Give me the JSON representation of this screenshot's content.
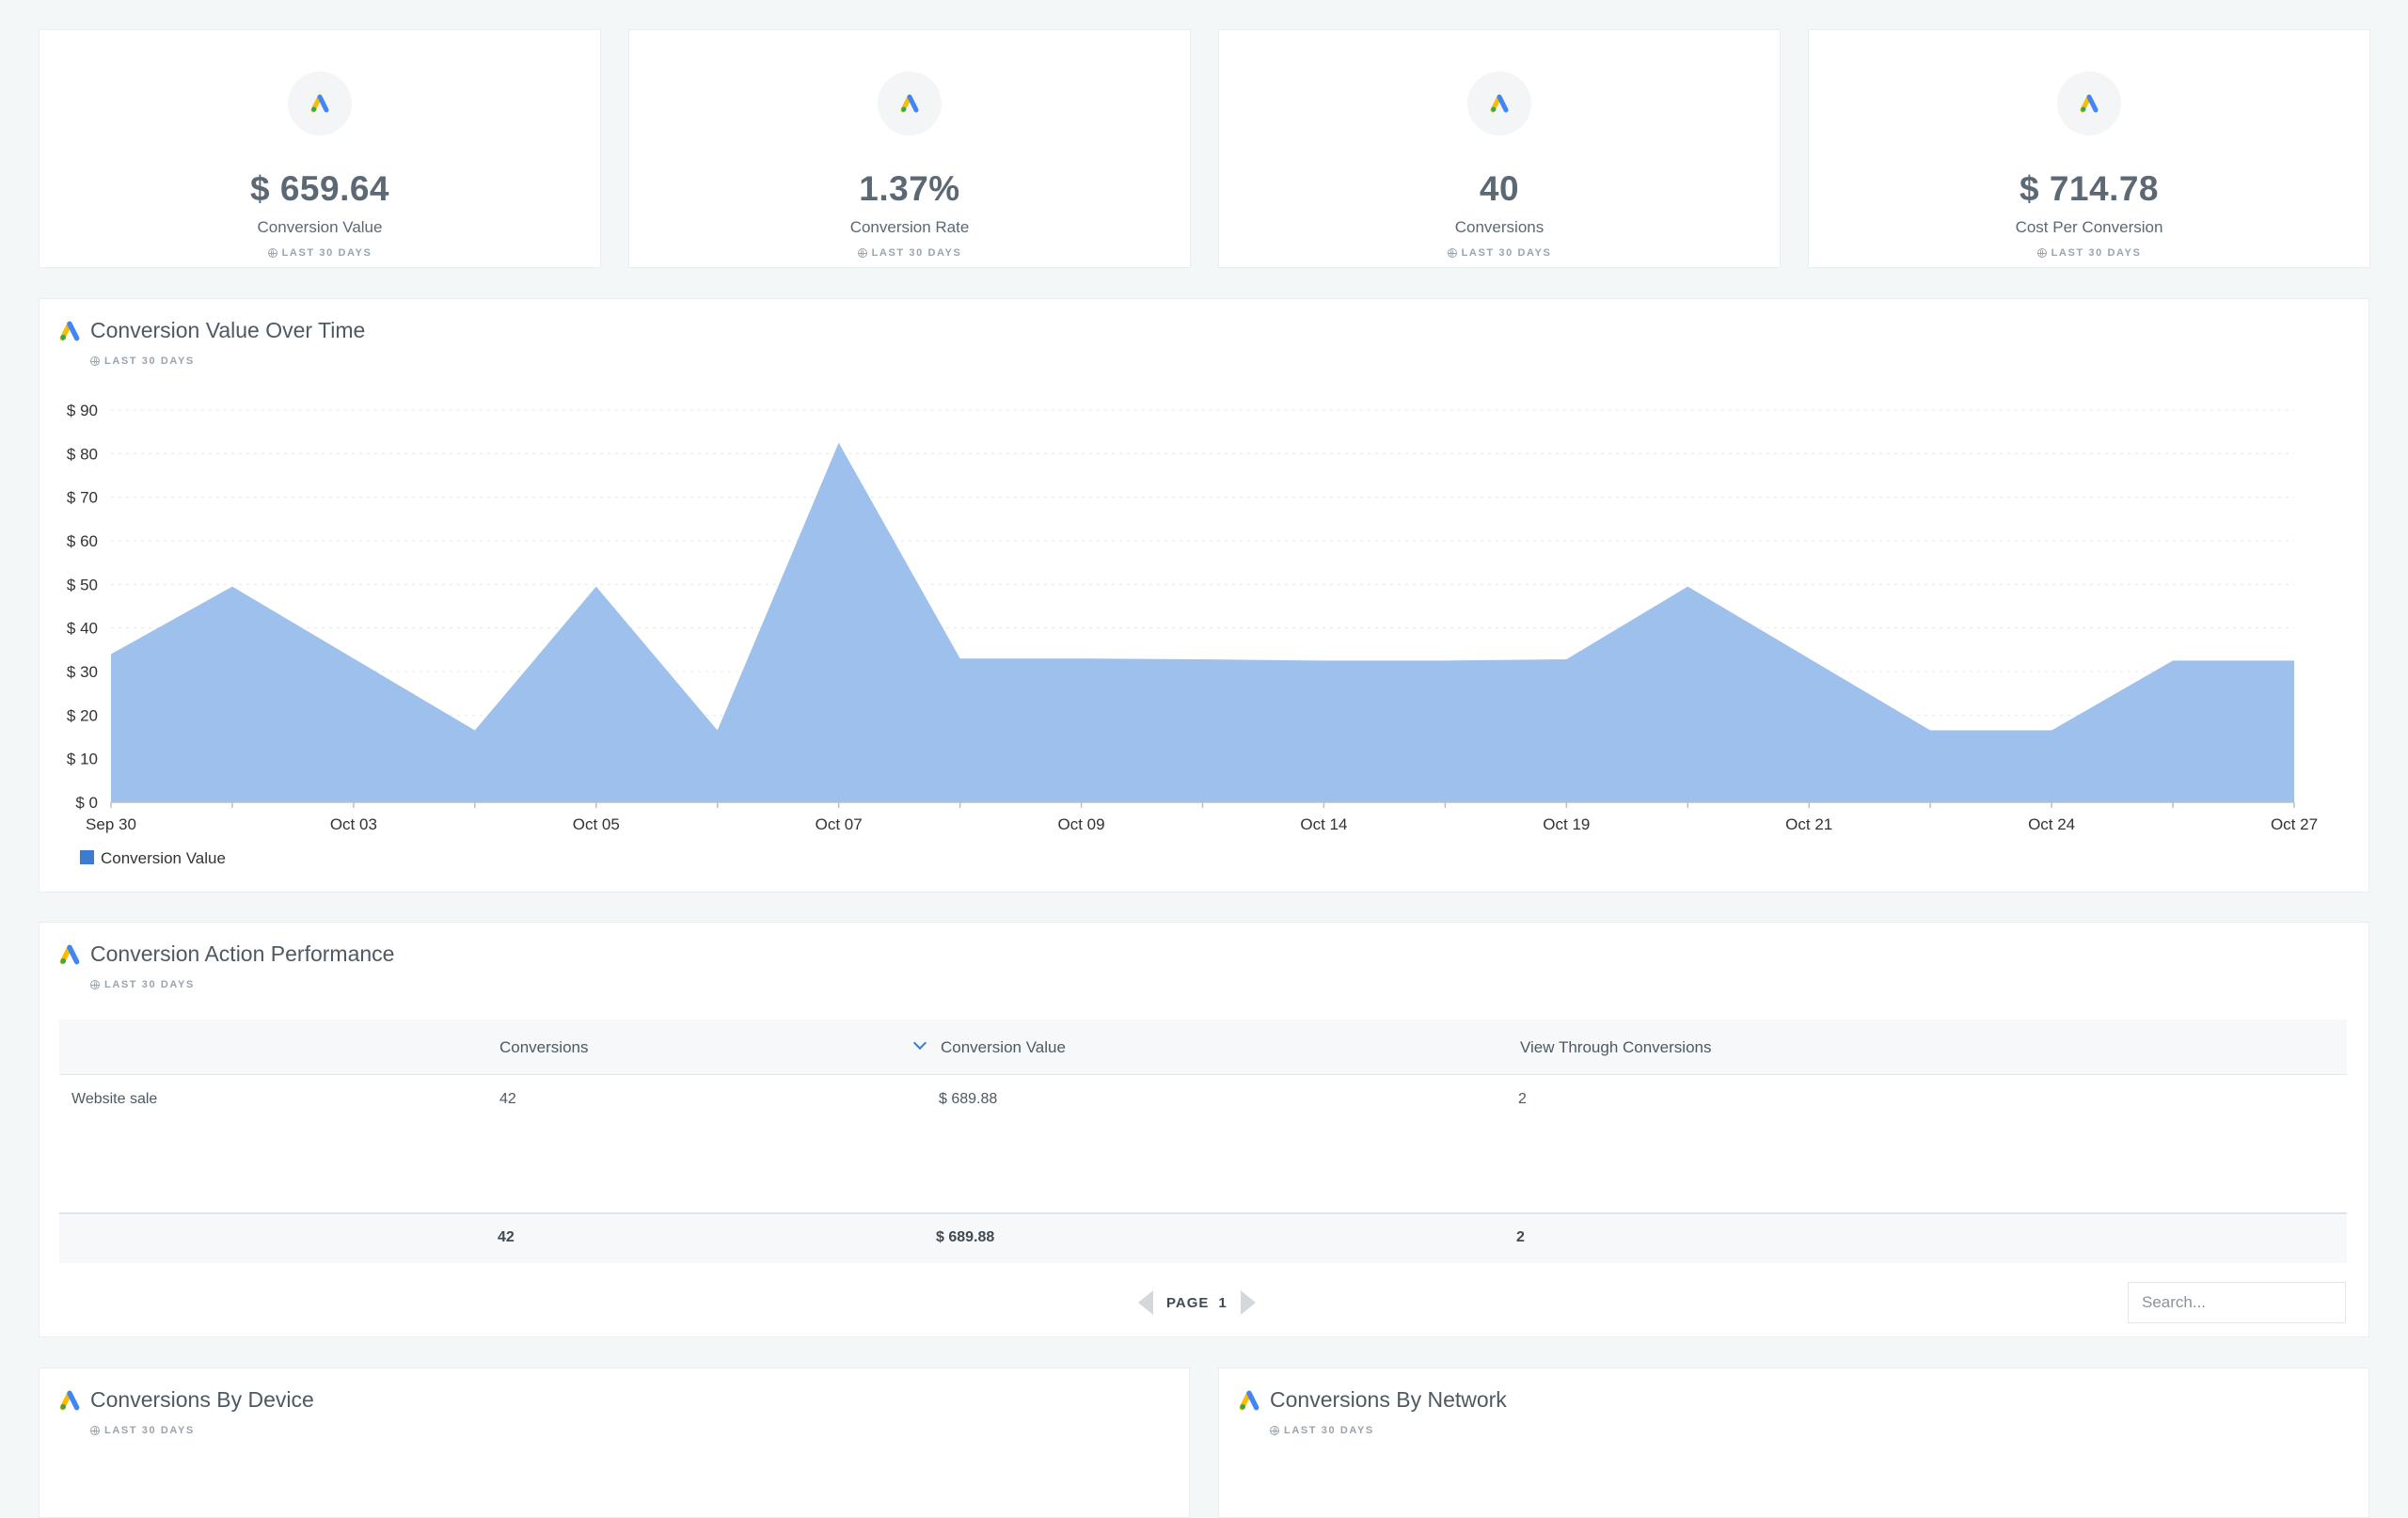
{
  "kpis": [
    {
      "value": "$ 659.64",
      "label": "Conversion Value",
      "period": "LAST 30 DAYS"
    },
    {
      "value": "1.37%",
      "label": "Conversion Rate",
      "period": "LAST 30 DAYS"
    },
    {
      "value": "40",
      "label": "Conversions",
      "period": "LAST 30 DAYS"
    },
    {
      "value": "$ 714.78",
      "label": "Cost Per Conversion",
      "period": "LAST 30 DAYS"
    }
  ],
  "icons": {
    "logo": "google-ads-logo-icon",
    "period": "globe-icon",
    "sort": "chevron-down-icon",
    "prev": "triangle-left-icon",
    "next": "triangle-right-icon"
  },
  "colors": {
    "area": "#9dc0ec",
    "legend": "#3d7bd0",
    "ads_blue": "#4285f4",
    "ads_yellow": "#fbbc04",
    "ads_green": "#34a853"
  },
  "chart_section": {
    "title": "Conversion Value Over Time",
    "period": "LAST 30 DAYS"
  },
  "chart_data": {
    "type": "area",
    "title": "Conversion Value Over Time",
    "x": [
      "Sep 30",
      "",
      "Oct 03",
      "",
      "Oct 05",
      "",
      "Oct 07",
      "",
      "Oct 09",
      "",
      "Oct 14",
      "",
      "Oct 19",
      "",
      "Oct 21",
      "",
      "Oct 24",
      "",
      "Oct 27"
    ],
    "x_tick_labels": [
      "Sep 30",
      "Oct 03",
      "Oct 05",
      "Oct 07",
      "Oct 09",
      "Oct 14",
      "Oct 19",
      "Oct 21",
      "Oct 24",
      "Oct 27"
    ],
    "series": [
      {
        "name": "Conversion Value",
        "values": [
          34,
          49.5,
          33,
          16.5,
          49.5,
          16.5,
          82.5,
          33,
          33,
          32.8,
          32.5,
          32.5,
          32.8,
          49.5,
          33,
          16.5,
          16.5,
          32.5,
          32.5
        ]
      }
    ],
    "y_tick_labels": [
      "$ 0",
      "$ 10",
      "$ 20",
      "$ 30",
      "$ 40",
      "$ 50",
      "$ 60",
      "$ 70",
      "$ 80",
      "$ 90"
    ],
    "ylim": [
      0,
      90
    ],
    "grid": true,
    "legend": "bottom-left"
  },
  "table_section": {
    "title": "Conversion Action Performance",
    "period": "LAST 30 DAYS",
    "columns": [
      "",
      "Conversions",
      "Conversion Value",
      "View Through Conversions"
    ],
    "rows": [
      {
        "name": "Website sale",
        "conversions": "42",
        "value": "$ 689.88",
        "view_through": "2"
      }
    ],
    "totals": {
      "conversions": "42",
      "value": "$ 689.88",
      "view_through": "2"
    },
    "page_label": "PAGE",
    "page_number": "1",
    "search_placeholder": "Search..."
  },
  "device_section": {
    "title": "Conversions By Device",
    "period": "LAST 30 DAYS"
  },
  "network_section": {
    "title": "Conversions By Network",
    "period": "LAST 30 DAYS"
  }
}
